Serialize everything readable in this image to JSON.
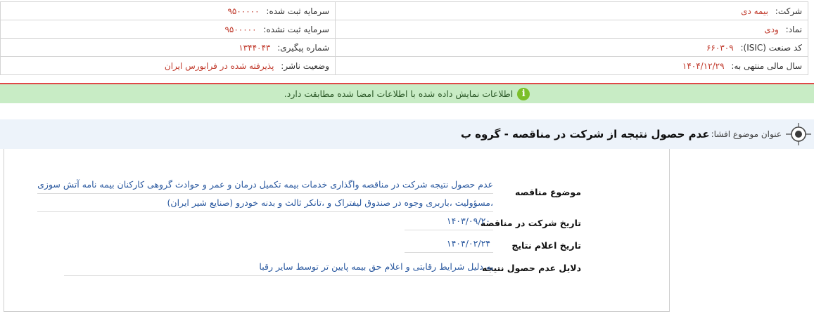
{
  "company_info": {
    "company_label": "شرکت:",
    "company_value": "بیمه دی",
    "symbol_label": "نماد:",
    "symbol_value": "ودی",
    "isic_label": "کد صنعت (ISIC):",
    "isic_value": "۶۶۰۳۰۹",
    "fiscal_year_label": "سال مالی منتهی به:",
    "fiscal_year_value": "۱۴۰۴/۱۲/۲۹",
    "registered_capital_label": "سرمایه ثبت شده:",
    "registered_capital_value": "۹۵۰۰۰۰۰",
    "unregistered_capital_label": "سرمایه ثبت نشده:",
    "unregistered_capital_value": "۹۵۰۰۰۰۰",
    "tracking_label": "شماره پیگیری:",
    "tracking_value": "۱۳۴۴۰۴۳",
    "publisher_status_label": "وضعیت ناشر:",
    "publisher_status_value": "پذیرفته شده در فرابورس ایران"
  },
  "notice": {
    "icon": "info-icon",
    "text": "اطلاعات نمایش داده شده با اطلاعات امضا شده مطابقت دارد."
  },
  "subject": {
    "icon": "target-icon",
    "label": "عنوان موضوع افشا:",
    "title": "عدم حصول نتیجه از شرکت در مناقصه - گروه ب"
  },
  "details": {
    "tender_subject_label": "موضوع مناقصه",
    "tender_subject_line1": "عدم حصول نتیجه شرکت در مناقصه واگذاری خدمات بیمه تکمیل درمان و عمر و حوادث گروهی کارکنان بیمه نامه آتش سوزی",
    "tender_subject_line2": "،مسؤولیت ،باربری وجوه در صندوق لیفتراک و ،تانکر ثالث و بدنه خودرو (صنایع شیر ایران)",
    "participation_date_label": "تاریخ شرکت در مناقصه",
    "participation_date_value": "۱۴۰۳/۰۹/۲۰",
    "results_date_label": "تاریخ اعلام نتایج",
    "results_date_value": "۱۴۰۴/۰۲/۲۴",
    "reasons_label": "دلایل عدم حصول نتیجه",
    "reasons_value": "به دلیل شرایط رقابتی و اعلام حق بیمه پایین تر توسط سایر رقبا"
  },
  "colors": {
    "value_red": "#c0392b",
    "value_blue": "#2c5aa0",
    "notice_bg": "#c8ecc5",
    "notice_border": "#e04848",
    "subject_bg": "#edf3fa"
  }
}
